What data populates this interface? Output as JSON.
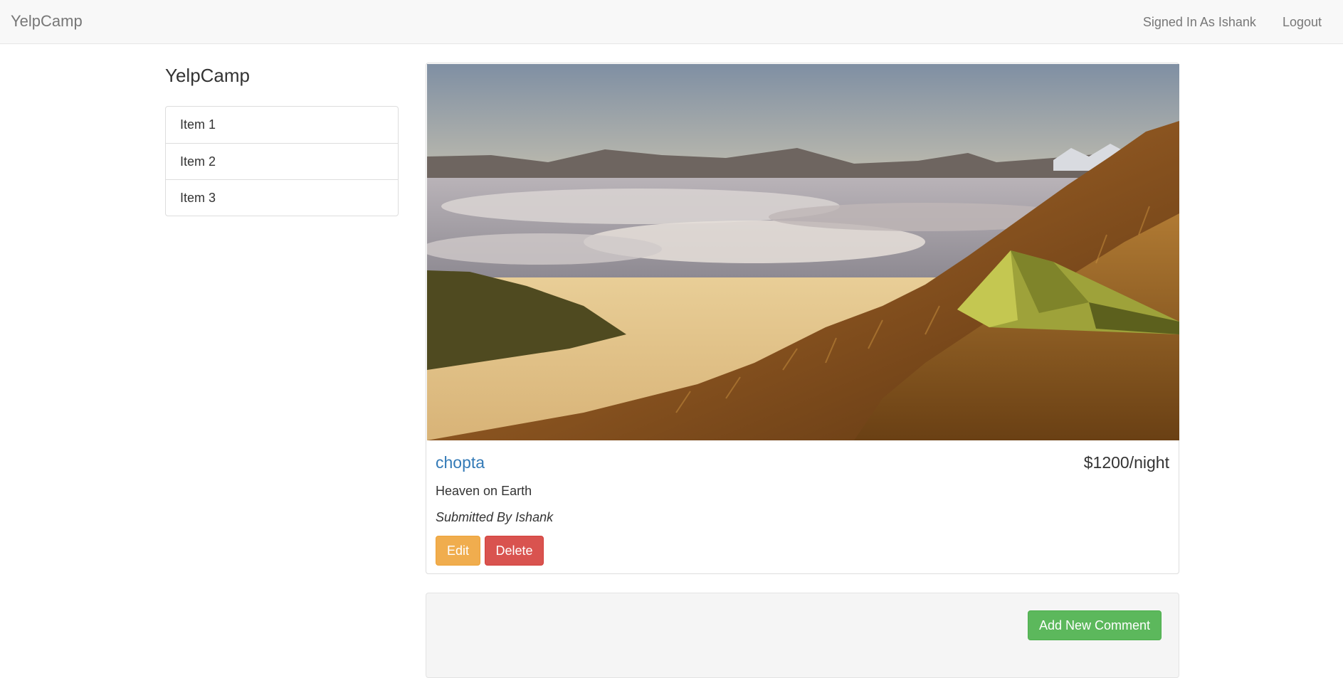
{
  "navbar": {
    "brand": "YelpCamp",
    "signed_in": "Signed In As Ishank",
    "logout": "Logout"
  },
  "sidebar": {
    "title": "YelpCamp",
    "items": [
      {
        "label": "Item 1"
      },
      {
        "label": "Item 2"
      },
      {
        "label": "Item 3"
      }
    ]
  },
  "campground": {
    "image_icon": "campground-photo-mountain-tent",
    "name": "chopta",
    "price": "$1200/night",
    "description": "Heaven on Earth",
    "author": "Submitted By Ishank",
    "edit_label": "Edit",
    "delete_label": "Delete"
  },
  "comments": {
    "add_label": "Add New Comment"
  },
  "colors": {
    "link": "#337ab7",
    "edit": "#f0ad4e",
    "delete": "#d9534f",
    "add_comment": "#5cb85c",
    "navbar_bg": "#f8f8f8"
  }
}
